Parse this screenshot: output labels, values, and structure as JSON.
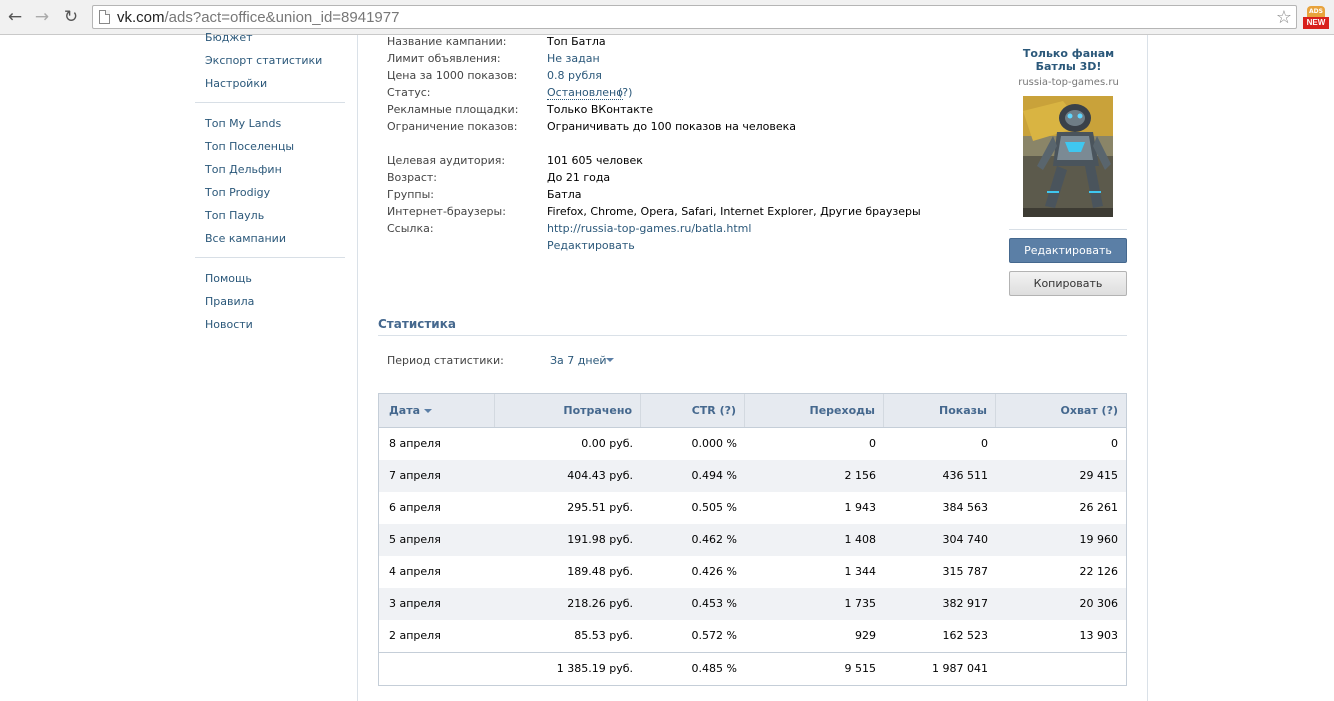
{
  "browser": {
    "url_host": "vk.com",
    "url_path": "/ads?act=office&union_id=8941977",
    "ext_badge_top": "ADS",
    "ext_badge": "NEW"
  },
  "sidebar": {
    "group1": [
      "Бюджет",
      "Экспорт статистики",
      "Настройки"
    ],
    "group2": [
      "Топ My Lands",
      "Топ Поселенцы",
      "Топ Дельфин",
      "Топ Prodigy",
      "Топ Пауль",
      "Все кампании"
    ],
    "group3": [
      "Помощь",
      "Правила",
      "Новости"
    ]
  },
  "info": {
    "campaign_label": "Название кампании:",
    "campaign_val": "Топ Батла",
    "limit_label": "Лимит объявления:",
    "limit_val": "Не задан",
    "price_label": "Цена за 1000 показов:",
    "price_val": "0.8 рубля",
    "status_label": "Статус:",
    "status_val": "Остановлено",
    "status_help": "(?)",
    "platforms_label": "Рекламные площадки:",
    "platforms_val": "Только ВКонтакте",
    "cap_label": "Ограничение показов:",
    "cap_val": "Ограничивать до 100 показов на человека",
    "audience_label": "Целевая аудитория:",
    "audience_val": "101 605 человек",
    "age_label": "Возраст:",
    "age_val": "До 21 года",
    "groups_label": "Группы:",
    "groups_val": "Батла",
    "browsers_label": "Интернет-браузеры:",
    "browsers_val": "Firefox, Chrome, Opera, Safari, Internet Explorer, Другие браузеры",
    "link_label": "Ссылка:",
    "link_val": "http://russia-top-games.ru/batla.html",
    "edit_link": "Редактировать"
  },
  "ad": {
    "title": "Только фанам Батлы 3D!",
    "domain": "russia-top-games.ru",
    "edit_button": "Редактировать",
    "copy_button": "Копировать"
  },
  "stats": {
    "title": "Статистика",
    "period_label": "Период статистики:",
    "period_value": "За 7 дней",
    "columns": {
      "date": "Дата",
      "spent": "Потрачено",
      "ctr": "CTR (?)",
      "clicks": "Переходы",
      "shows": "Показы",
      "reach": "Охват (?)"
    },
    "rows": [
      {
        "date": "8 апреля",
        "spent": "0.00 руб.",
        "ctr": "0.000 %",
        "clicks": "0",
        "shows": "0",
        "reach": "0"
      },
      {
        "date": "7 апреля",
        "spent": "404.43 руб.",
        "ctr": "0.494 %",
        "clicks": "2 156",
        "shows": "436 511",
        "reach": "29 415"
      },
      {
        "date": "6 апреля",
        "spent": "295.51 руб.",
        "ctr": "0.505 %",
        "clicks": "1 943",
        "shows": "384 563",
        "reach": "26 261"
      },
      {
        "date": "5 апреля",
        "spent": "191.98 руб.",
        "ctr": "0.462 %",
        "clicks": "1 408",
        "shows": "304 740",
        "reach": "19 960"
      },
      {
        "date": "4 апреля",
        "spent": "189.48 руб.",
        "ctr": "0.426 %",
        "clicks": "1 344",
        "shows": "315 787",
        "reach": "22 126"
      },
      {
        "date": "3 апреля",
        "spent": "218.26 руб.",
        "ctr": "0.453 %",
        "clicks": "1 735",
        "shows": "382 917",
        "reach": "20 306"
      },
      {
        "date": "2 апреля",
        "spent": "85.53 руб.",
        "ctr": "0.572 %",
        "clicks": "929",
        "shows": "162 523",
        "reach": "13 903"
      }
    ],
    "totals": {
      "spent": "1 385.19 руб.",
      "ctr": "0.485 %",
      "clicks": "9 515",
      "shows": "1 987 041",
      "reach": ""
    }
  }
}
